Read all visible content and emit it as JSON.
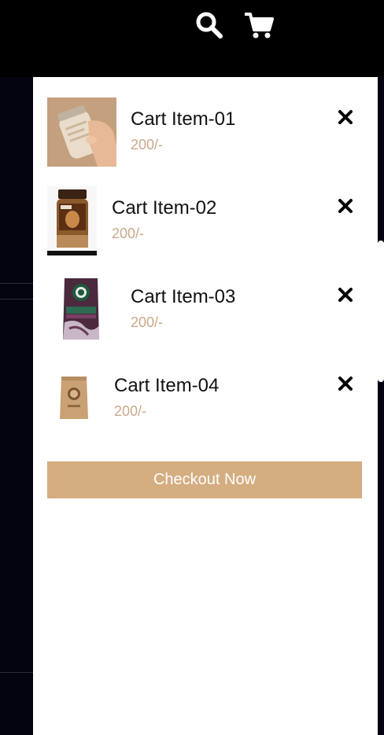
{
  "header": {
    "icons": [
      "search-icon",
      "cart-icon"
    ]
  },
  "cart": {
    "items": [
      {
        "title": "Cart Item-01",
        "price": "200/-",
        "image": "coffee-jar-in-hand",
        "remove_icon": "close-icon"
      },
      {
        "title": "Cart Item-02",
        "price": "200/-",
        "image": "instant-coffee-jar",
        "remove_icon": "close-icon"
      },
      {
        "title": "Cart Item-03",
        "price": "200/-",
        "image": "espresso-coffee-bag",
        "remove_icon": "close-icon"
      },
      {
        "title": "Cart Item-04",
        "price": "200/-",
        "image": "kraft-coffee-pouch",
        "remove_icon": "close-icon"
      }
    ],
    "checkout_label": "Checkout Now"
  },
  "colors": {
    "background": "#000000",
    "panel": "#ffffff",
    "accent": "#d4ad80",
    "price": "#caa98a",
    "text": "#111111"
  }
}
